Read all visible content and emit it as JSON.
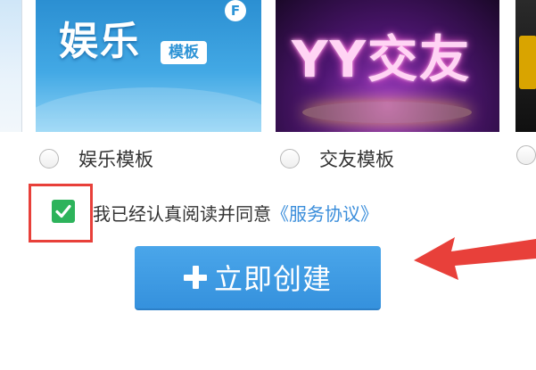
{
  "templates": [
    {
      "id": "yule",
      "label": "娱乐模板",
      "thumb_text": "娱乐",
      "thumb_badge": "模板",
      "thumb_corner": "F"
    },
    {
      "id": "jiaoyou",
      "label": "交友模板",
      "thumb_text": "YY交友"
    }
  ],
  "agreement": {
    "checked": true,
    "text": "我已经认真阅读并同意",
    "link_text": "《服务协议》"
  },
  "create_button": {
    "label": "立即创建",
    "icon": "plus-icon"
  },
  "colors": {
    "button": "#3d9be3",
    "checkbox": "#2db35b",
    "annotation": "#e8403a",
    "link": "#3b8edb"
  }
}
